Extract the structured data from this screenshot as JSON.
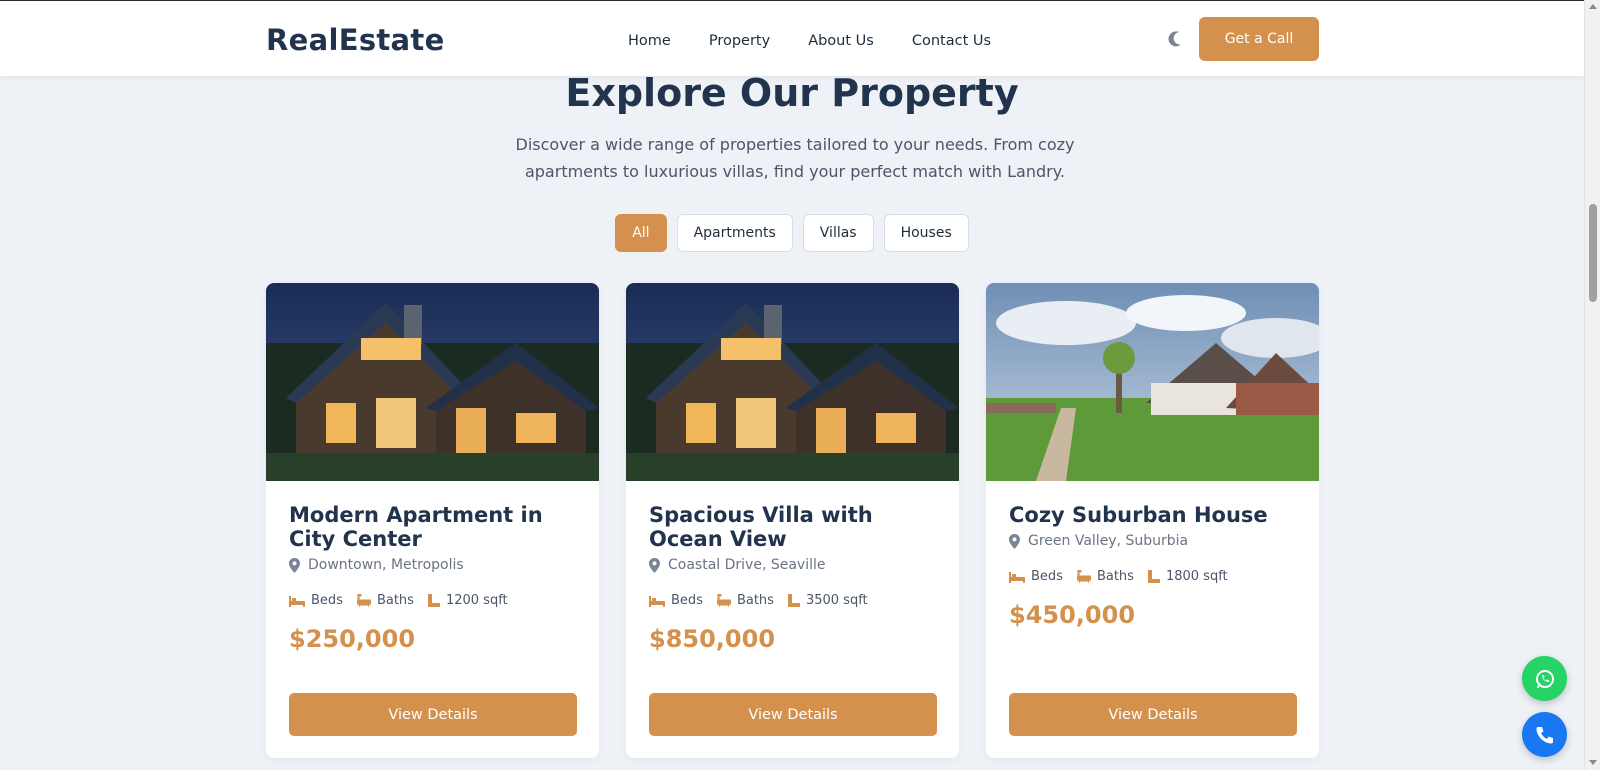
{
  "header": {
    "brand": "RealEstate",
    "nav": [
      "Home",
      "Property",
      "About Us",
      "Contact Us"
    ],
    "theme_icon": "moon-icon",
    "cta_label": "Get a Call"
  },
  "section": {
    "title": "Explore Our Property",
    "subtitle": "Discover a wide range of properties tailored to your needs. From cozy apartments to luxurious villas, find your perfect match with Landry."
  },
  "filters": [
    "All",
    "Apartments",
    "Villas",
    "Houses"
  ],
  "active_filter": "All",
  "cards": [
    {
      "title": "Modern Apartment in City Center",
      "location": "Downtown, Metropolis",
      "beds": "Beds",
      "baths": "Baths",
      "area": "1200 sqft",
      "price": "$250,000",
      "button": "View Details"
    },
    {
      "title": "Spacious Villa with Ocean View",
      "location": "Coastal Drive, Seaville",
      "beds": "Beds",
      "baths": "Baths",
      "area": "3500 sqft",
      "price": "$850,000",
      "button": "View Details"
    },
    {
      "title": "Cozy Suburban House",
      "location": "Green Valley, Suburbia",
      "beds": "Beds",
      "baths": "Baths",
      "area": "1800 sqft",
      "price": "$450,000",
      "button": "View Details"
    }
  ],
  "colors": {
    "accent": "#d4914d",
    "heading": "#22344d",
    "background": "#eef2f7",
    "whatsapp": "#25d366",
    "call": "#1877f2"
  },
  "floating": [
    "whatsapp-icon",
    "phone-icon"
  ]
}
